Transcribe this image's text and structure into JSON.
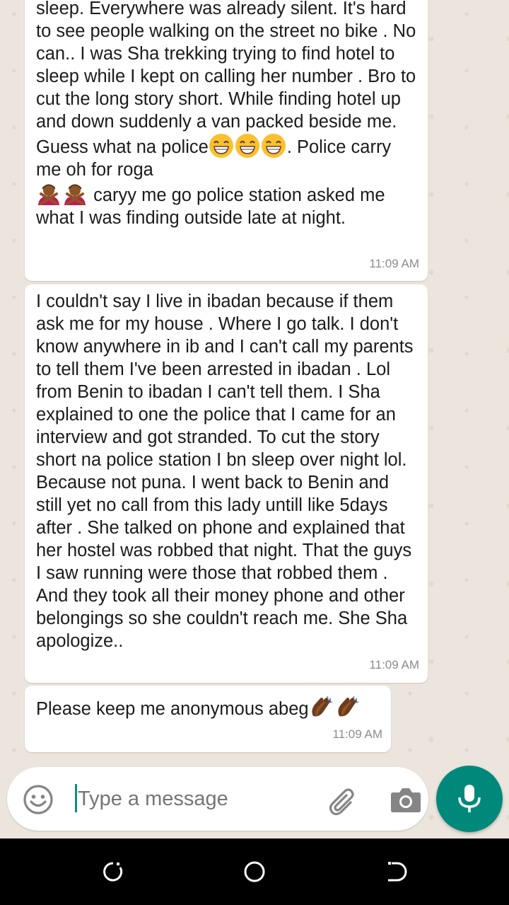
{
  "messages": [
    {
      "text_before_emoji": "sleep. Everywhere was already silent. It's hard to see people walking on the street no bike . No can.. I was Sha trekking trying to find hotel to sleep while I kept on calling her number . Bro to cut the long story short. While finding hotel up and down suddenly a van packed beside me. Guess what na police",
      "text_middle": ". Police carry me oh for roga ",
      "text_after_emoji": " caryy me go police station asked me what I was finding outside late at night.",
      "emoji_1": [
        "grinning-face-emoji",
        "grinning-face-emoji",
        "grinning-face-emoji"
      ],
      "emoji_2": [
        "person-gesturing-no-emoji",
        "person-gesturing-no-emoji"
      ],
      "time": "11:09 AM"
    },
    {
      "text": "I couldn't say I live in ibadan because if them ask me for my house . Where I go talk. I don't know anywhere in ib and I can't call my parents to tell them I've been arrested in ibadan . Lol from Benin to ibadan I can't tell them. I Sha explained to one the police that I came for an interview and got stranded. To cut the story short na police station I bn sleep over night lol. Because not puna. I went back to Benin and still yet no call from this lady untill like 5days after . She talked on phone and explained that her hostel was robbed that night. That the guys I saw running were those that robbed them . And they took all their money phone and other belongings so she couldn't reach me. She Sha apologize..",
      "time": "11:09 AM"
    },
    {
      "text": "Please keep me anonymous abeg",
      "emoji": [
        "clapping-hands-emoji",
        "clapping-hands-emoji"
      ],
      "time": "11:09 AM"
    }
  ],
  "composer": {
    "placeholder": "Type a message",
    "emoji_icon": "smiley-icon",
    "attach_icon": "paperclip-icon",
    "camera_icon": "camera-icon"
  },
  "mic_button": {
    "icon": "microphone-icon",
    "color": "#00897b"
  },
  "navbar": {
    "icons": [
      "recent-apps-icon",
      "home-icon",
      "back-icon"
    ]
  },
  "colors": {
    "wallpaper": "#ece5dd",
    "bubble": "#ffffff",
    "accent": "#128c7e",
    "timestamp": "#8c8c8c"
  }
}
